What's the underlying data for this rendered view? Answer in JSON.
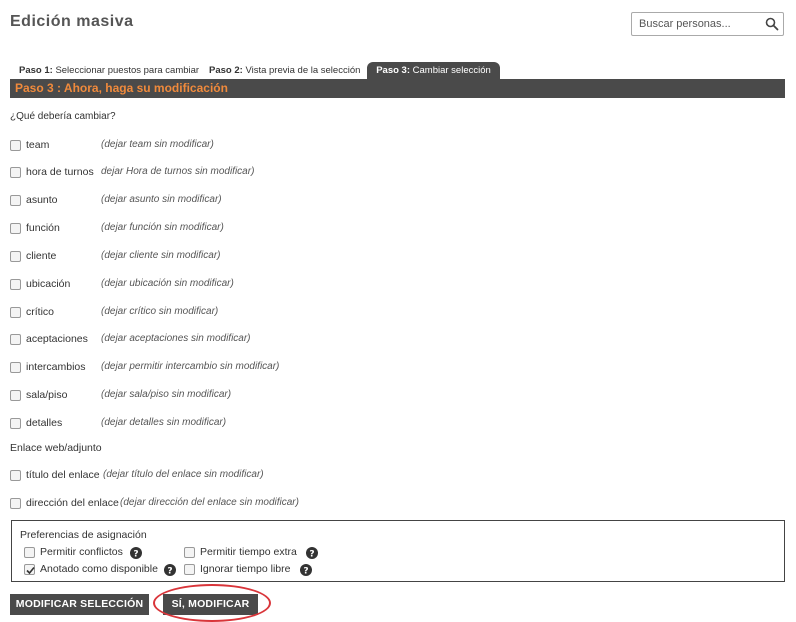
{
  "page": {
    "title": "Edición masiva"
  },
  "search": {
    "placeholder": "Buscar personas...",
    "icon": "search-icon"
  },
  "tabs": [
    {
      "step": "Paso 1:",
      "text": "Seleccionar puestos para cambiar",
      "active": false
    },
    {
      "step": "Paso 2:",
      "text": "Vista previa de la selección",
      "active": false
    },
    {
      "step": "Paso 3:",
      "text": "Cambiar selección",
      "active": true
    }
  ],
  "step_bar": {
    "text": "Paso 3 : Ahora, haga su modificación",
    "color": "#f08a3c"
  },
  "question": "¿Qué debería cambiar?",
  "fields": [
    {
      "label": "team",
      "hint": "(dejar team sin modificar)",
      "checked": false
    },
    {
      "label": "hora de turnos",
      "hint": "dejar Hora de turnos sin modificar)",
      "checked": false
    },
    {
      "label": "asunto",
      "hint": "(dejar asunto sin modificar)",
      "checked": false
    },
    {
      "label": "función",
      "hint": "(dejar función sin modificar)",
      "checked": false
    },
    {
      "label": "cliente",
      "hint": "(dejar cliente sin modificar)",
      "checked": false
    },
    {
      "label": "ubicación",
      "hint": "(dejar ubicación sin modificar)",
      "checked": false
    },
    {
      "label": "crítico",
      "hint": "(dejar crítico sin modificar)",
      "checked": false
    },
    {
      "label": "aceptaciones",
      "hint": "(dejar aceptaciones sin modificar)",
      "checked": false
    },
    {
      "label": "intercambios",
      "hint": "(dejar permitir intercambio sin modificar)",
      "checked": false
    },
    {
      "label": "sala/piso",
      "hint": "(dejar sala/piso sin modificar)",
      "checked": false
    },
    {
      "label": "detalles",
      "hint": "(dejar detalles sin modificar)",
      "checked": false
    }
  ],
  "link_section": {
    "title": "Enlace web/adjunto",
    "fields": [
      {
        "label": "título del enlace",
        "hint": "(dejar título del enlace sin modificar)",
        "checked": false
      },
      {
        "label": "dirección del enlace",
        "hint": "(dejar dirección del enlace sin modificar)",
        "checked": false
      }
    ]
  },
  "preferences": {
    "title": "Preferencias de asignación",
    "items": [
      {
        "label": "Permitir conflictos",
        "checked": false,
        "help_icon": "help-icon"
      },
      {
        "label": "Permitir tiempo extra",
        "checked": false,
        "help_icon": "help-icon"
      },
      {
        "label": "Anotado como disponible",
        "checked": true,
        "help_icon": "help-icon"
      },
      {
        "label": "Ignorar tiempo libre",
        "checked": false,
        "help_icon": "help-icon"
      }
    ]
  },
  "buttons": {
    "modify_selection": "MODIFICAR SELECCIÓN",
    "confirm": "SÍ, MODIFICAR"
  },
  "colors": {
    "dark_bar": "#4a4a4a",
    "accent_orange": "#f08a3c",
    "highlight_red": "#d9353a"
  }
}
